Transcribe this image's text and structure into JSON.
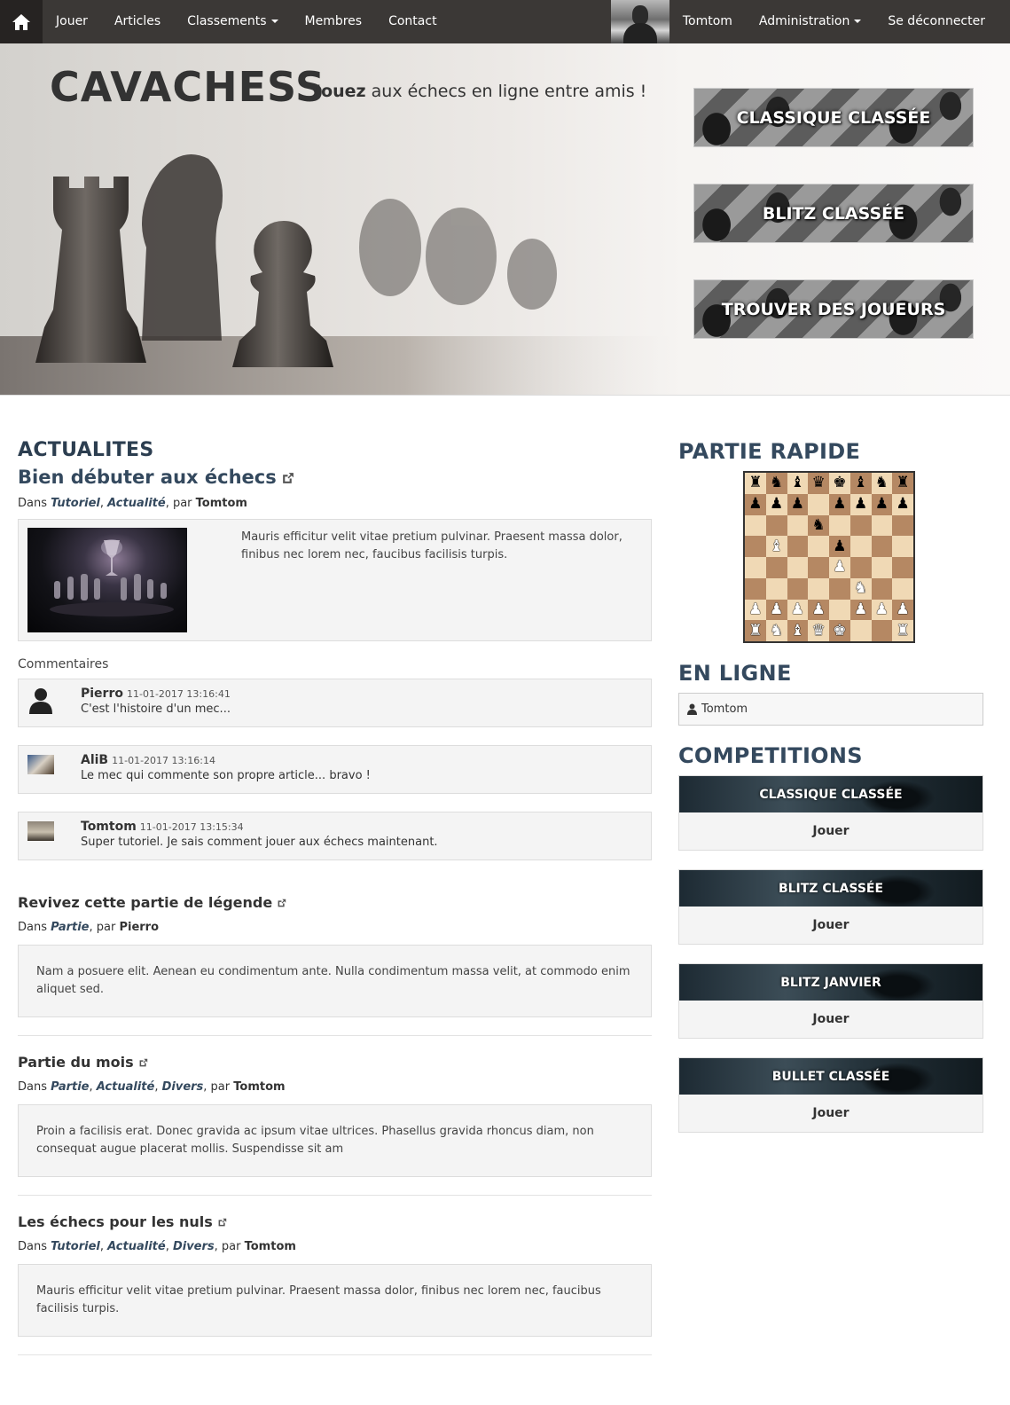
{
  "nav": {
    "home_icon": "home-icon",
    "left": [
      {
        "label": "Jouer",
        "dropdown": false
      },
      {
        "label": "Articles",
        "dropdown": false
      },
      {
        "label": "Classements",
        "dropdown": true
      },
      {
        "label": "Membres",
        "dropdown": false
      },
      {
        "label": "Contact",
        "dropdown": false
      }
    ],
    "user": "Tomtom",
    "admin": "Administration",
    "logout": "Se déconnecter"
  },
  "hero": {
    "title": "CAVACHESS",
    "tagline_bold": "Jouez",
    "tagline_rest": " aux échecs en ligne entre amis !",
    "buttons": [
      "CLASSIQUE CLASSÉE",
      "BLITZ CLASSÉE",
      "TROUVER DES JOUEURS"
    ]
  },
  "news": {
    "heading": "ACTUALITES",
    "featured": {
      "title": "Bien débuter aux échecs",
      "meta_prefix": "Dans ",
      "categories": [
        "Tutoriel",
        "Actualité"
      ],
      "author": "Tomtom",
      "text": "Mauris efficitur velit vitae pretium pulvinar. Praesent massa dolor, finibus nec lorem nec, faucibus facilisis turpis.",
      "comments_label": "Commentaires",
      "comments": [
        {
          "name": "Pierro",
          "date": "11-01-2017 13:16:41",
          "text": "C'est l'histoire d'un mec...",
          "avatar": "default"
        },
        {
          "name": "AliB",
          "date": "11-01-2017 13:16:14",
          "text": "Le mec qui commente son propre article... bravo !",
          "avatar": "photo"
        },
        {
          "name": "Tomtom",
          "date": "11-01-2017 13:15:34",
          "text": "Super tutoriel. Je sais comment jouer aux échecs maintenant.",
          "avatar": "photo"
        }
      ]
    },
    "articles": [
      {
        "title": "Revivez cette partie de légende",
        "categories": [
          "Partie"
        ],
        "author": "Pierro",
        "text": "Nam a posuere elit. Aenean eu condimentum ante. Nulla condimentum massa velit, at commodo enim aliquet sed."
      },
      {
        "title": "Partie du mois",
        "categories": [
          "Partie",
          "Actualité",
          "Divers"
        ],
        "author": "Tomtom",
        "text": "Proin a facilisis erat. Donec gravida ac ipsum vitae ultrices. Phasellus gravida rhoncus diam, non consequat augue placerat mollis. Suspendisse sit am"
      },
      {
        "title": "Les échecs pour les nuls",
        "categories": [
          "Tutoriel",
          "Actualité",
          "Divers"
        ],
        "author": "Tomtom",
        "text": "Mauris efficitur velit vitae pretium pulvinar. Praesent massa dolor, finibus nec lorem nec, faucibus facilisis turpis."
      }
    ],
    "by": ", par "
  },
  "sidebar": {
    "quick_game": "PARTIE RAPIDE",
    "board": [
      "rnbqkbnr",
      "ppp.pppp",
      "...n....",
      ".B..p...",
      "....P...",
      ".....N..",
      "PPPP.PPP",
      "RNBQK..R"
    ],
    "online_heading": "EN LIGNE",
    "online_users": [
      "Tomtom"
    ],
    "competitions_heading": "COMPETITIONS",
    "competitions": [
      {
        "name": "CLASSIQUE CLASSÉE",
        "action": "Jouer"
      },
      {
        "name": "BLITZ CLASSÉE",
        "action": "Jouer"
      },
      {
        "name": "BLITZ JANVIER",
        "action": "Jouer"
      },
      {
        "name": "BULLET CLASSÉE",
        "action": "Jouer"
      }
    ]
  },
  "colors": {
    "navbar": "#3b3836",
    "heading": "#34495e",
    "panel": "#f4f4f4"
  }
}
